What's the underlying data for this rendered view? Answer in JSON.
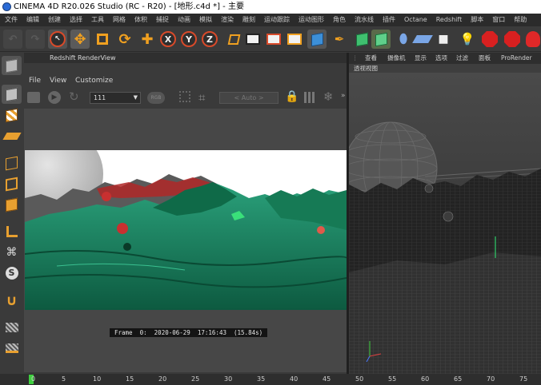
{
  "window": {
    "title": "CINEMA 4D R20.026 Studio (RC - R20) - [地形.c4d *] - 主要"
  },
  "menubar": {
    "items": [
      "文件",
      "编辑",
      "创建",
      "选择",
      "工具",
      "网格",
      "体积",
      "捕捉",
      "动画",
      "模拟",
      "渲染",
      "雕刻",
      "运动跟踪",
      "运动图形",
      "角色",
      "流水线",
      "插件",
      "Octane",
      "Redshift",
      "脚本",
      "窗口",
      "帮助"
    ]
  },
  "toolbar": {
    "icons": [
      "undo-icon",
      "redo-icon",
      "live-selection-icon",
      "move-icon",
      "scale-icon",
      "rotate-icon",
      "move-icon",
      "x-axis-icon",
      "y-axis-icon",
      "z-axis-icon",
      "coordinate-system-icon",
      "render-region-icon",
      "render-view-icon",
      "render-settings-icon",
      "cube-icon",
      "pen-icon",
      "subdivision-icon",
      "array-icon",
      "deformer-icon",
      "floor-icon",
      "camera-icon",
      "light-icon",
      "redshift-ipr-icon",
      "redshift-stop-icon",
      "redshift-light-icon"
    ],
    "x_label": "X",
    "y_label": "Y",
    "z_label": "Z"
  },
  "render_view": {
    "title": "Redshift RenderView",
    "menu": [
      "File",
      "View",
      "Customize"
    ],
    "snapshot_value": "111",
    "aov_dropdown": "< Auto >",
    "frame_info": "Frame  0:  2020-06-29  17:16:43  (15.84s)"
  },
  "viewport": {
    "tabs": [
      "查看",
      "摄像机",
      "显示",
      "选项",
      "过滤",
      "面板",
      "ProRender"
    ],
    "label": "透视视图"
  },
  "timeline": {
    "ticks": [
      "0",
      "5",
      "10",
      "15",
      "20",
      "25",
      "30",
      "35",
      "40",
      "45",
      "50",
      "55",
      "60",
      "65",
      "70",
      "75"
    ]
  },
  "colors": {
    "accent_orange": "#f0a020",
    "axis_red": "#d84a2a",
    "terrain_green": "#1f8a64",
    "timeline_marker": "#3fcf3f"
  }
}
